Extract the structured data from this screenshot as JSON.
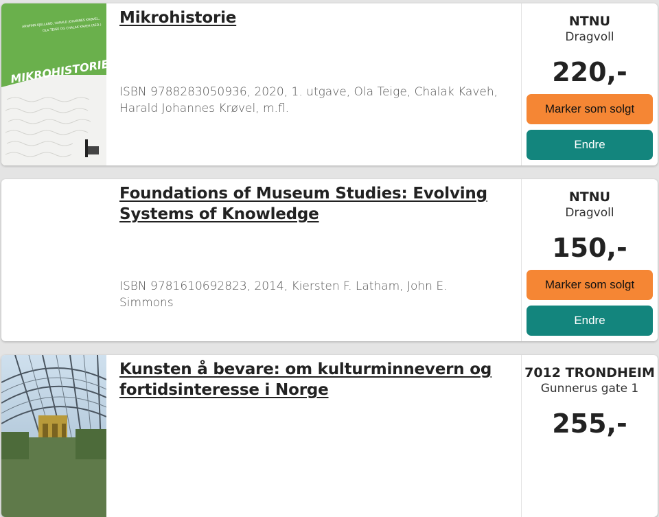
{
  "listings": [
    {
      "title": "Mikrohistorie",
      "meta": "ISBN 9788283050936, 2020, 1. utgave, Ola Teige, Chalak Kaveh, Harald Johannes Krøvel, m.fl.",
      "location": "NTNU",
      "sublocation": "Dragvoll",
      "price": "220,-",
      "cover": {
        "title": "MIKROHISTORIE",
        "authors_line1": "ARNFINN KJELLAND, HARALD JOHANNES KRØVEL,",
        "authors_line2": "OLA TEIGE OG CHALAK KAVEH (RED.)",
        "color": "#6ab04c"
      },
      "sold_label": "Marker som solgt",
      "edit_label": "Endre"
    },
    {
      "title": "Foundations of Museum Studies: Evolving Systems of Knowledge",
      "meta": "ISBN 9781610692823, 2014, Kiersten F. Latham, John E. Simmons",
      "location": "NTNU",
      "sublocation": "Dragvoll",
      "price": "150,-",
      "sold_label": "Marker som solgt",
      "edit_label": "Endre"
    },
    {
      "title": "Kunsten å bevare: om kulturminnevern og fortidsinteresse i Norge",
      "location": "7012 TRONDHEIM",
      "sublocation": "Gunnerus gate 1",
      "price": "255,-"
    }
  ],
  "colors": {
    "sold_button": "#f58634",
    "edit_button": "#13857d",
    "background": "#e4e4e4"
  }
}
